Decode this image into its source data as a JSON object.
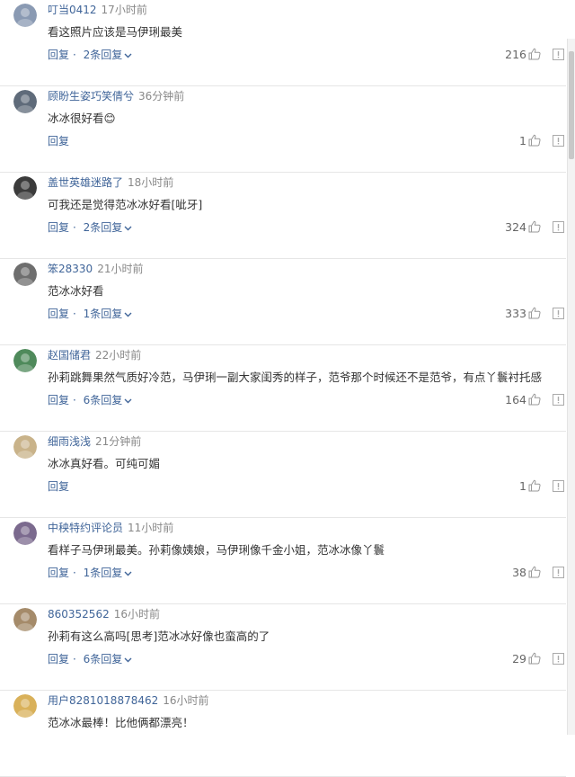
{
  "comments": [
    {
      "avatar_color": "#8a9ab3",
      "username": "叮当0412",
      "time": "17小时前",
      "text": "看这照片应该是马伊琍最美",
      "reply_label": "回复",
      "replies_label": "2条回复",
      "likes": "216"
    },
    {
      "avatar_color": "#5f6b7a",
      "username": "顾盼生姿巧笑倩兮",
      "time": "36分钟前",
      "text": "冰冰很好看😊",
      "reply_label": "回复",
      "replies_label": "",
      "likes": "1"
    },
    {
      "avatar_color": "#3b3b3b",
      "username": "盖世英雄迷路了",
      "time": "18小时前",
      "text": "可我还是觉得范冰冰好看[呲牙]",
      "reply_label": "回复",
      "replies_label": "2条回复",
      "likes": "324"
    },
    {
      "avatar_color": "#6e6e6e",
      "username": "笨28330",
      "time": "21小时前",
      "text": "范冰冰好看",
      "reply_label": "回复",
      "replies_label": "1条回复",
      "likes": "333"
    },
    {
      "avatar_color": "#4f8a5b",
      "username": "赵国储君",
      "time": "22小时前",
      "text": "孙莉跳舞果然气质好冷范，马伊琍一副大家闺秀的样子，范爷那个时候还不是范爷，有点丫鬟衬托感",
      "reply_label": "回复",
      "replies_label": "6条回复",
      "likes": "164"
    },
    {
      "avatar_color": "#c9b38a",
      "username": "细雨浅浅",
      "time": "21分钟前",
      "text": "冰冰真好看。可纯可媚",
      "reply_label": "回复",
      "replies_label": "",
      "likes": "1"
    },
    {
      "avatar_color": "#7b6a8e",
      "username": "中秧特约评论员",
      "time": "11小时前",
      "text": "看样子马伊琍最美。孙莉像姨娘，马伊琍像千金小姐，范冰冰像丫鬟",
      "reply_label": "回复",
      "replies_label": "1条回复",
      "likes": "38"
    },
    {
      "avatar_color": "#a58b6a",
      "username": "860352562",
      "time": "16小时前",
      "text": "孙莉有这么高吗[思考]范冰冰好像也蛮高的了",
      "reply_label": "回复",
      "replies_label": "6条回复",
      "likes": "29"
    },
    {
      "avatar_color": "#d9b15a",
      "username": "用户8281018878462",
      "time": "16小时前",
      "text": "范冰冰最棒！比他俩都漂亮！",
      "reply_label": "",
      "replies_label": "",
      "likes": ""
    }
  ],
  "ui": {
    "separator": "·",
    "like_icon": "thumbs-up-icon",
    "report_icon": "report-icon",
    "chevron_icon": "chevron-down-icon",
    "link_color": "#406599"
  }
}
